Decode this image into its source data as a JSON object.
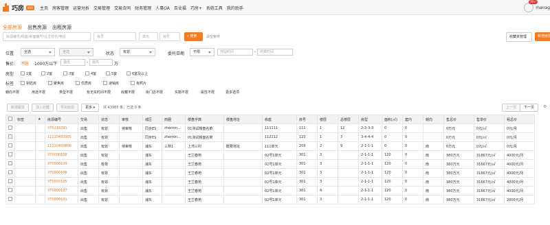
{
  "app": {
    "name": "巧房",
    "badge": "V10"
  },
  "nav": [
    "主页",
    "房客管理",
    "运营分析",
    "交易管理",
    "交易合同",
    "财务管理",
    "人事OA",
    "百业福",
    "巧房+",
    "系统工具",
    "我的助手"
  ],
  "user": {
    "badge": "99+",
    "name": "manag"
  },
  "tabs": [
    "全部房源",
    "出售房源",
    "出租房源"
  ],
  "search": {
    "main_placeholder": "房源编号/楼盘/街面编号/业主姓名/电话",
    "building_placeholder": "栋号",
    "unit_placeholder": "单元",
    "room_placeholder": "房号",
    "search_button": "搜索",
    "clear": "清空条件",
    "fav_manage": "收藏夹管理",
    "add_button": "新增房源"
  },
  "filters": {
    "location_label": "位置",
    "location_value": "全选",
    "location_sub": "全选",
    "status_label": "状态",
    "status_value": "有效",
    "date_label": "委托日期",
    "date_value": "不限",
    "start_placeholder": "开始时间",
    "end_placeholder": "结束时间",
    "price_label": "售价:",
    "price_opts": [
      "不限",
      "1000万以下"
    ],
    "min_placeholder": "最低",
    "max_placeholder": "最高",
    "price_unit": "万",
    "room_label": "房型",
    "room_opts": [
      "1室",
      "2室",
      "3室",
      "4室",
      "5室",
      "6室及以上"
    ],
    "tag_label": "标签",
    "tag_opts": [
      "钥匙房",
      "聚焦房",
      "优质房",
      "速销房",
      "有照片"
    ],
    "dropdowns": [
      "朝向不限",
      "用途不限",
      "类型不限",
      "有无实时间不限",
      "收藏不限",
      "街门店不限",
      "实勘不限",
      "属性不限",
      "更多选项"
    ]
  },
  "toolbar": {
    "buttons": [
      "新增跟进",
      "加入收藏",
      "导出房源"
    ],
    "more": "更多",
    "count_text": "共 43985 条，已选 0 条",
    "prev": "上一页",
    "next": "下一页"
  },
  "table": {
    "headers": [
      "",
      "标签",
      "★",
      "房源编号",
      "交易",
      "状态",
      "审核",
      "城区",
      "商圈",
      "楼盘字典",
      "楼盘地址",
      "栋座",
      "房号",
      "楼层",
      "总楼层",
      "房型",
      "面积(㎡)",
      "套内",
      "朝向",
      "售总价",
      "售单价",
      "租总价"
    ],
    "rows": [
      [
        "",
        "",
        "",
        "XT0218291",
        "出售",
        "有效",
        "待审核",
        "同步ES",
        "zherron...",
        "01测试楼盘名菜",
        "",
        "111111",
        "111",
        "1",
        "12",
        "2-3-3-3",
        "0",
        "0",
        "",
        "0万元",
        "0元/㎡",
        "0元/月"
      ],
      [
        "",
        "",
        "",
        "11110483905",
        "出售",
        "有效",
        "",
        "同步ES",
        "zherron...",
        "01测试楼盘名菜",
        "",
        "112112",
        "123",
        "1",
        "3",
        "3-4-4-4",
        "0",
        "0",
        "",
        "0万元",
        "0元/㎡",
        "0元/月"
      ],
      [
        "",
        "",
        "",
        "11110483896",
        "出售",
        "有效",
        "待审核",
        "浦东",
        "三林1",
        "上湾三村",
        "概要地址",
        "111单元",
        "209",
        "2",
        "9",
        "2-1-1-1",
        "0",
        "0",
        "南",
        "0万元",
        "0元/㎡",
        "0元/月"
      ],
      [
        "",
        "",
        "",
        "XT0000108",
        "出售",
        "有效",
        "",
        "浦东",
        "",
        "王兰春苑",
        "",
        "02号1单元",
        "301",
        "3",
        "",
        "2-1-1-1",
        "120",
        "0",
        "南",
        "380万元",
        "31667元/㎡",
        "4000元/月"
      ],
      [
        "",
        "",
        "",
        "XT0000109",
        "出售",
        "有效",
        "",
        "浦东",
        "",
        "王兰春苑",
        "",
        "02号1单元",
        "301",
        "3",
        "",
        "2-1-1-1",
        "120",
        "0",
        "南",
        "380万元",
        "31667元/㎡",
        "4000元/月"
      ],
      [
        "",
        "",
        "",
        "XT0000106",
        "出售",
        "有效",
        "",
        "浦东",
        "",
        "王兰春苑",
        "",
        "02号1单元",
        "301",
        "3",
        "",
        "2-1-1-1",
        "120",
        "0",
        "南",
        "380万元",
        "31667元/㎡",
        "4000元/月"
      ],
      [
        "",
        "",
        "",
        "XT0000105",
        "出售",
        "有效",
        "",
        "浦东",
        "",
        "王兰春苑",
        "",
        "02号1单元",
        "301",
        "3",
        "",
        "2-1-1-1",
        "120",
        "0",
        "南",
        "380万元",
        "31667元/㎡",
        "4000元/月"
      ],
      [
        "",
        "",
        "",
        "XT0000107",
        "出售",
        "有效",
        "",
        "浦东",
        "",
        "王兰春苑",
        "",
        "02号1单元",
        "301",
        "4",
        "",
        "2-1-1-1",
        "120",
        "0",
        "南",
        "380万元",
        "31667元/㎡",
        "4000元/月"
      ],
      [
        "",
        "",
        "",
        "XT0000101",
        "出售",
        "有效",
        "",
        "浦东",
        "",
        "王兰春苑",
        "",
        "02号1单元",
        "301",
        "3",
        "",
        "2-1-1-1",
        "120",
        "0",
        "南",
        "380万元",
        "31667元/㎡",
        "2800元/月"
      ]
    ]
  }
}
